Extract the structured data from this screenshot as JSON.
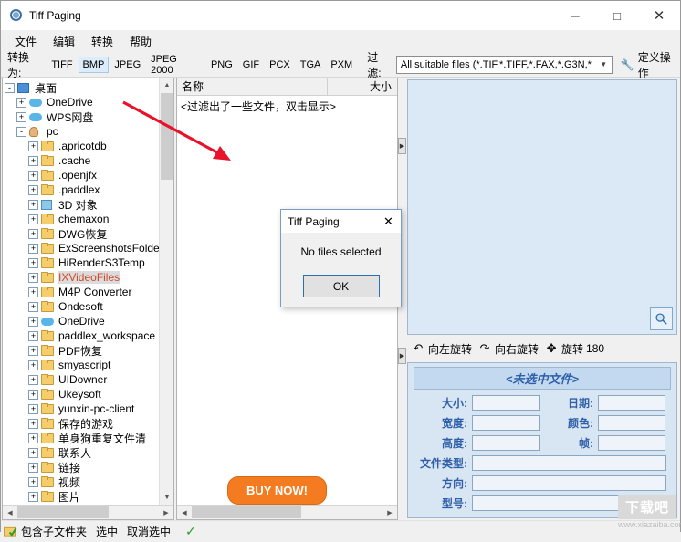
{
  "window": {
    "title": "Tiff Paging",
    "minimize": "─",
    "maximize": "□",
    "close": "✕"
  },
  "menubar": [
    {
      "label": "文件"
    },
    {
      "label": "编辑"
    },
    {
      "label": "转换"
    },
    {
      "label": "帮助"
    }
  ],
  "toolbar": {
    "convert_label": "转换为:",
    "formats": [
      {
        "label": "TIFF",
        "selected": false
      },
      {
        "label": "BMP",
        "selected": true
      },
      {
        "label": "JPEG",
        "selected": false
      },
      {
        "label": "JPEG 2000",
        "selected": false
      },
      {
        "label": "PNG",
        "selected": false
      },
      {
        "label": "GIF",
        "selected": false
      },
      {
        "label": "PCX",
        "selected": false
      },
      {
        "label": "TGA",
        "selected": false
      },
      {
        "label": "PXM",
        "selected": false
      }
    ],
    "filter_label": "过滤:",
    "filter_value": "All suitable files (*.TIF,*.TIFF,*.FAX,*.G3N,*",
    "custom_op_label": "定义操作"
  },
  "tree": [
    {
      "indent": 0,
      "expander": "-",
      "icon": "desktop",
      "label": "桌面",
      "style": "normal"
    },
    {
      "indent": 1,
      "expander": "+",
      "icon": "cloud",
      "label": "OneDrive",
      "style": "normal"
    },
    {
      "indent": 1,
      "expander": "+",
      "icon": "cloud",
      "label": "WPS网盘",
      "style": "normal"
    },
    {
      "indent": 1,
      "expander": "-",
      "icon": "person",
      "label": "pc",
      "style": "normal"
    },
    {
      "indent": 2,
      "expander": "+",
      "icon": "folder",
      "label": ".apricotdb",
      "style": "normal"
    },
    {
      "indent": 2,
      "expander": "+",
      "icon": "folder",
      "label": ".cache",
      "style": "normal"
    },
    {
      "indent": 2,
      "expander": "+",
      "icon": "folder",
      "label": ".openjfx",
      "style": "normal"
    },
    {
      "indent": 2,
      "expander": "+",
      "icon": "folder",
      "label": ".paddlex",
      "style": "normal"
    },
    {
      "indent": 2,
      "expander": "+",
      "icon": "obj",
      "label": "3D 对象",
      "style": "normal"
    },
    {
      "indent": 2,
      "expander": "+",
      "icon": "folder",
      "label": "chemaxon",
      "style": "normal"
    },
    {
      "indent": 2,
      "expander": "+",
      "icon": "folder",
      "label": "DWG恢复",
      "style": "normal"
    },
    {
      "indent": 2,
      "expander": "+",
      "icon": "folder",
      "label": "ExScreenshotsFolder",
      "style": "normal"
    },
    {
      "indent": 2,
      "expander": "+",
      "icon": "folder",
      "label": "HiRenderS3Temp",
      "style": "normal"
    },
    {
      "indent": 2,
      "expander": "+",
      "icon": "folder",
      "label": "IXVideoFiles",
      "style": "selected-red"
    },
    {
      "indent": 2,
      "expander": "+",
      "icon": "folder",
      "label": "M4P Converter",
      "style": "normal"
    },
    {
      "indent": 2,
      "expander": "+",
      "icon": "folder",
      "label": "Ondesoft",
      "style": "normal"
    },
    {
      "indent": 2,
      "expander": "+",
      "icon": "cloud",
      "label": "OneDrive",
      "style": "normal"
    },
    {
      "indent": 2,
      "expander": "+",
      "icon": "folder",
      "label": "paddlex_workspace",
      "style": "normal"
    },
    {
      "indent": 2,
      "expander": "+",
      "icon": "folder",
      "label": "PDF恢复",
      "style": "normal"
    },
    {
      "indent": 2,
      "expander": "+",
      "icon": "folder",
      "label": "smyascript",
      "style": "normal"
    },
    {
      "indent": 2,
      "expander": "+",
      "icon": "folder",
      "label": "UIDowner",
      "style": "normal"
    },
    {
      "indent": 2,
      "expander": "+",
      "icon": "folder",
      "label": "Ukeysoft",
      "style": "normal"
    },
    {
      "indent": 2,
      "expander": "+",
      "icon": "folder",
      "label": "yunxin-pc-client",
      "style": "normal"
    },
    {
      "indent": 2,
      "expander": "+",
      "icon": "folder",
      "label": "保存的游戏",
      "style": "normal"
    },
    {
      "indent": 2,
      "expander": "+",
      "icon": "folder",
      "label": "单身狗重复文件清",
      "style": "normal"
    },
    {
      "indent": 2,
      "expander": "+",
      "icon": "folder",
      "label": "联系人",
      "style": "normal"
    },
    {
      "indent": 2,
      "expander": "+",
      "icon": "folder",
      "label": "链接",
      "style": "normal"
    },
    {
      "indent": 2,
      "expander": "+",
      "icon": "folder",
      "label": "视频",
      "style": "normal"
    },
    {
      "indent": 2,
      "expander": "+",
      "icon": "folder",
      "label": "图片",
      "style": "normal"
    }
  ],
  "file_list": {
    "col_name": "名称",
    "col_size": "大小",
    "empty_text": "<过滤出了一些文件，双击显示>",
    "buy_now": "BUY NOW!"
  },
  "preview": {
    "zoom_icon": "⚲"
  },
  "rotation": {
    "left_label": "向左旋转",
    "right_label": "向右旋转",
    "r180_label": "旋转",
    "r180_value": "180"
  },
  "info": {
    "title": "<未选中文件>",
    "rows": [
      {
        "label": "大小:",
        "value": "",
        "label2": "日期:",
        "value2": ""
      },
      {
        "label": "宽度:",
        "value": "",
        "label2": "颜色:",
        "value2": ""
      },
      {
        "label": "高度:",
        "value": "",
        "label2": "帧:",
        "value2": ""
      }
    ],
    "full_rows": [
      {
        "label": "文件类型:",
        "value": ""
      },
      {
        "label": "方向:",
        "value": ""
      },
      {
        "label": "型号:",
        "value": ""
      }
    ]
  },
  "bottombar": {
    "include_subfolders": "包含子文件夹",
    "select_in": "选中",
    "deselect_in": "取消选中"
  },
  "dialog": {
    "title": "Tiff Paging",
    "close": "✕",
    "message": "No files selected",
    "ok": "OK"
  },
  "watermark": {
    "main": "下载吧",
    "sub": "www.xiazaiba.com"
  }
}
